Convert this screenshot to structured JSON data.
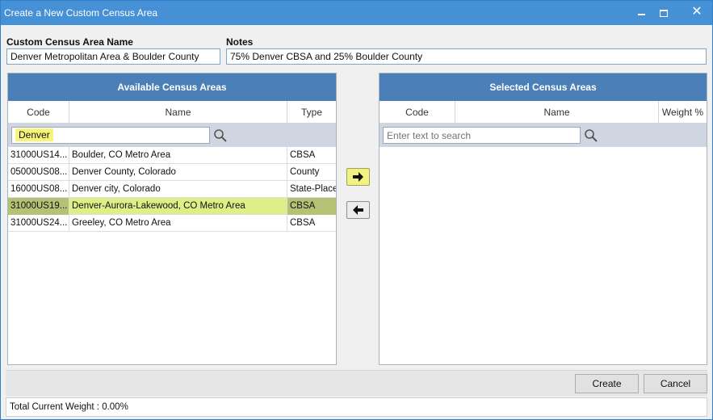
{
  "window": {
    "title": "Create a New Custom Census Area",
    "close_glyph": "✕"
  },
  "form": {
    "name_label": "Custom Census Area Name",
    "name_value": "Denver Metropolitan Area & Boulder County",
    "notes_label": "Notes",
    "notes_value": "75% Denver CBSA and 25% Boulder County"
  },
  "available": {
    "title": "Available Census Areas",
    "columns": {
      "code": "Code",
      "name": "Name",
      "type": "Type"
    },
    "filter_value": "Denver",
    "rows": [
      {
        "code": "31000US14...",
        "name": "Boulder, CO Metro Area",
        "type": "CBSA",
        "selected": false
      },
      {
        "code": "05000US08...",
        "name": "Denver County, Colorado",
        "type": "County",
        "selected": false
      },
      {
        "code": "16000US08...",
        "name": "Denver city, Colorado",
        "type": "State-Place",
        "selected": false
      },
      {
        "code": "31000US19...",
        "name": "Denver-Aurora-Lakewood, CO Metro Area",
        "type": "CBSA",
        "selected": true
      },
      {
        "code": "31000US24...",
        "name": "Greeley, CO Metro Area",
        "type": "CBSA",
        "selected": false
      }
    ]
  },
  "selected": {
    "title": "Selected Census Areas",
    "columns": {
      "code": "Code",
      "name": "Name",
      "weight": "Weight %"
    },
    "filter_placeholder": "Enter text to search",
    "rows": []
  },
  "actions": {
    "create_label": "Create",
    "cancel_label": "Cancel"
  },
  "status": {
    "total_weight_text": "Total Current Weight : 0.00%"
  },
  "colors": {
    "titlebar": "#4690d6",
    "panel_header": "#4a7fb8",
    "selected_row": "#dfee87",
    "filter_highlight": "#f6f47a"
  },
  "icons": [
    "search-icon",
    "arrow-right-icon",
    "arrow-left-icon",
    "minimize-icon",
    "maximize-icon",
    "close-icon"
  ]
}
